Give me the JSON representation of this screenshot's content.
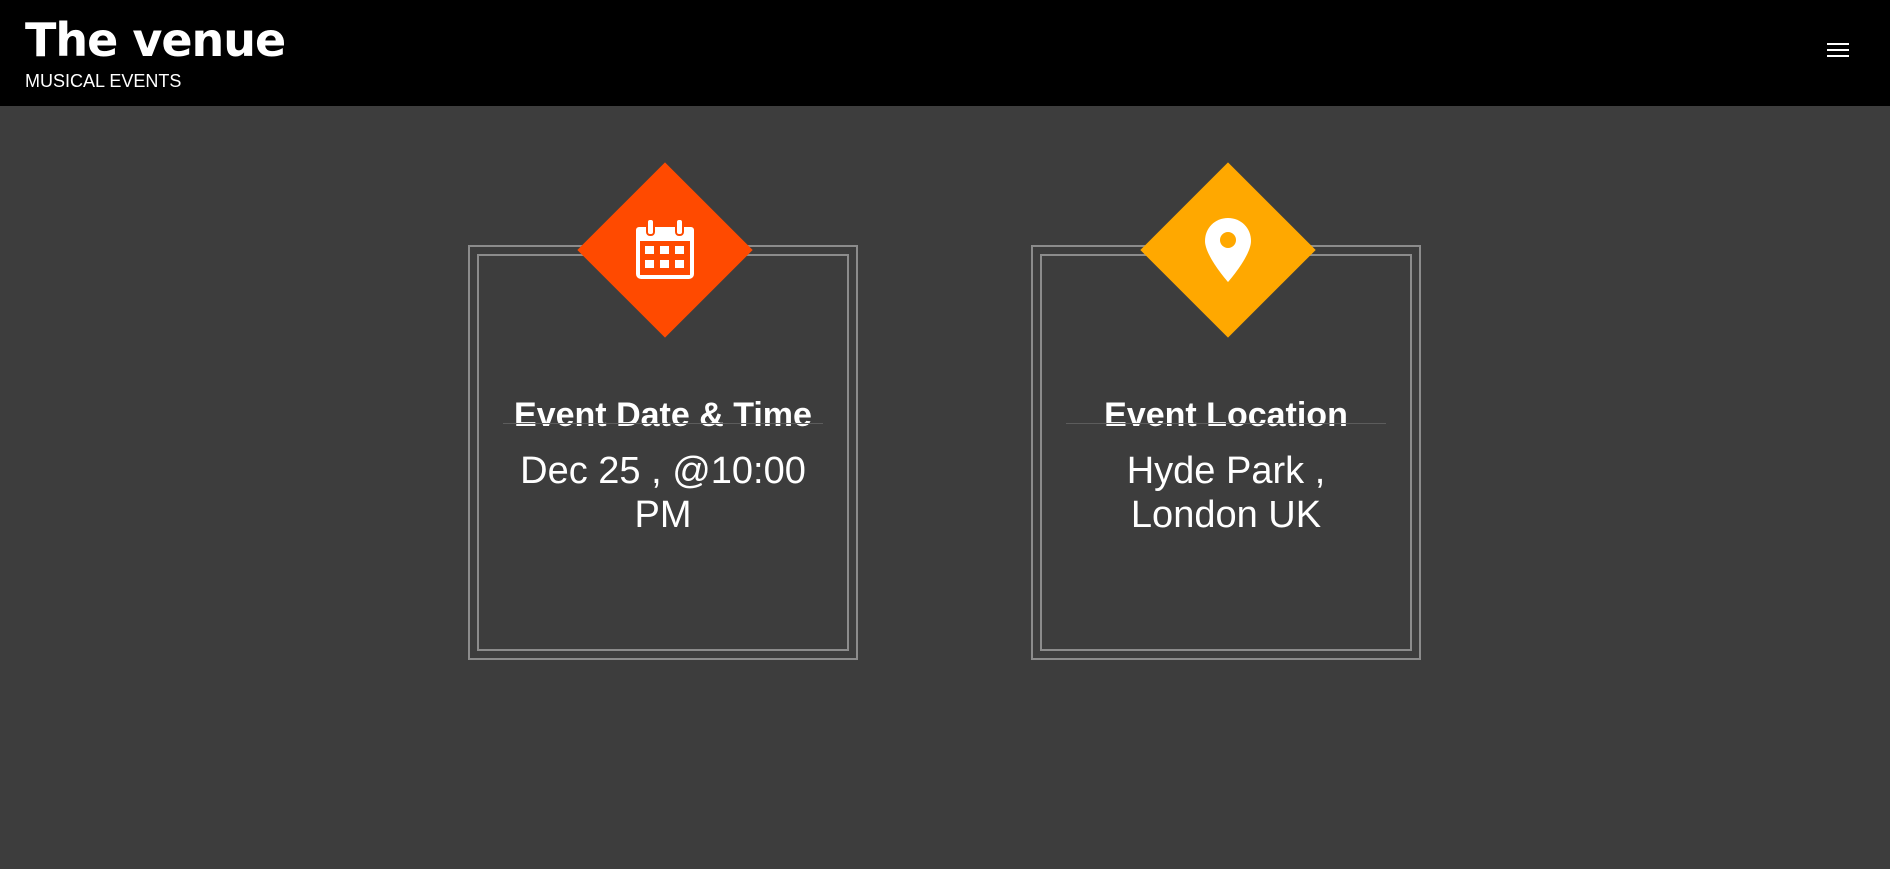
{
  "header": {
    "title": "The venue",
    "subtitle": "MUSICAL EVENTS",
    "menu_icon": "hamburger-menu-icon"
  },
  "cards": [
    {
      "icon": "calendar-icon",
      "accent_color": "#ff4a00",
      "title": "Event Date & Time",
      "value": "Dec 25 , @10:00 PM"
    },
    {
      "icon": "map-pin-icon",
      "accent_color": "#ffa800",
      "title": "Event Location",
      "value": "Hyde Park , London UK"
    }
  ],
  "colors": {
    "header_bg": "#000000",
    "page_bg": "#3d3d3d",
    "card_border": "#8c8c8c",
    "text": "#ffffff"
  }
}
